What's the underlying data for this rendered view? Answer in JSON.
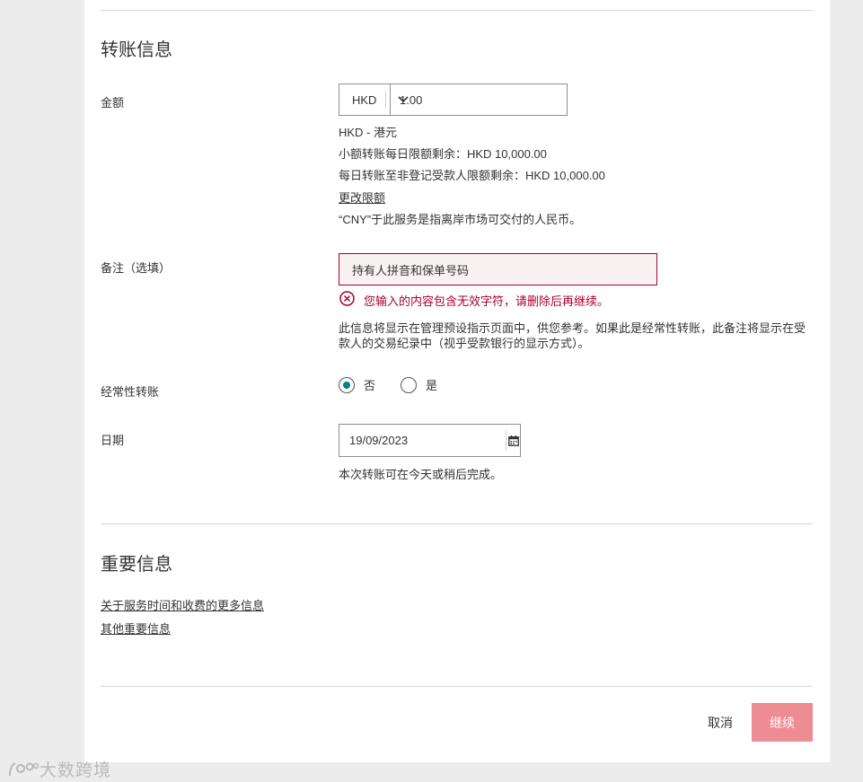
{
  "transfer": {
    "title": "转账信息",
    "amount": {
      "label": "金额",
      "currency": "HKD",
      "value": "1.00",
      "currency_desc": "HKD - 港元",
      "small_limit": "小额转账每日限额剩余：HKD 10,000.00",
      "unregistered_limit": "每日转账至非登记受款人限额剩余：HKD 10,000.00",
      "change_limit_link": "更改限额",
      "cny_note": "“CNY”于此服务是指离岸市场可交付的人民币。"
    },
    "remark": {
      "label": "备注（选填）",
      "value": "持有人拼音和保单号码",
      "error": "您输入的内容包含无效字符，请删除后再继续。",
      "hint": "此信息将显示在管理预设指示页面中，供您参考。如果此是经常性转账，此备注将显示在受款人的交易纪录中（视乎受款银行的显示方式）。"
    },
    "recurring": {
      "label": "经常性转账",
      "options": [
        "否",
        "是"
      ],
      "selected": "否"
    },
    "date": {
      "label": "日期",
      "value": "19/09/2023",
      "note": "本次转账可在今天或稍后完成。"
    }
  },
  "important": {
    "title": "重要信息",
    "links": [
      "关于服务时间和收费的更多信息",
      "其他重要信息"
    ]
  },
  "actions": {
    "cancel_label": "取消",
    "continue_label": "继续"
  },
  "watermark": {
    "text": "大数跨境"
  },
  "colors": {
    "error": "#a8002b",
    "radio_accent": "#00847f",
    "continue_button": "#ee8c94",
    "background": "#ececec"
  }
}
